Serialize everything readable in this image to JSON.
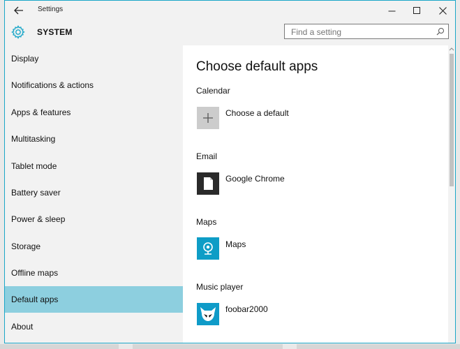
{
  "window": {
    "title": "Settings",
    "back_icon": "arrow-left-icon",
    "controls": [
      "minimize-icon",
      "maximize-icon",
      "close-icon"
    ]
  },
  "header": {
    "section_icon": "gear-icon",
    "title": "SYSTEM"
  },
  "search": {
    "placeholder": "Find a setting",
    "value": ""
  },
  "sidebar": {
    "items": [
      {
        "label": "Display"
      },
      {
        "label": "Notifications & actions"
      },
      {
        "label": "Apps & features"
      },
      {
        "label": "Multitasking"
      },
      {
        "label": "Tablet mode"
      },
      {
        "label": "Battery saver"
      },
      {
        "label": "Power & sleep"
      },
      {
        "label": "Storage"
      },
      {
        "label": "Offline maps"
      },
      {
        "label": "Default apps",
        "selected": true
      },
      {
        "label": "About"
      }
    ]
  },
  "main": {
    "title": "Choose default apps",
    "sections": [
      {
        "label": "Calendar",
        "app": "Choose a default",
        "icon": "plus-icon"
      },
      {
        "label": "Email",
        "app": "Google Chrome",
        "icon": "document-icon"
      },
      {
        "label": "Maps",
        "app": "Maps",
        "icon": "maps-icon"
      },
      {
        "label": "Music player",
        "app": "foobar2000",
        "icon": "foobar-alien-icon"
      }
    ]
  },
  "colors": {
    "accent": "#8dcfdf",
    "window_border": "#1aa6c8",
    "sidebar_bg": "#f2f2f2",
    "maps_tile": "#0e9dc6",
    "email_tile": "#2a2a2a",
    "music_tile": "#0f9bc8"
  }
}
